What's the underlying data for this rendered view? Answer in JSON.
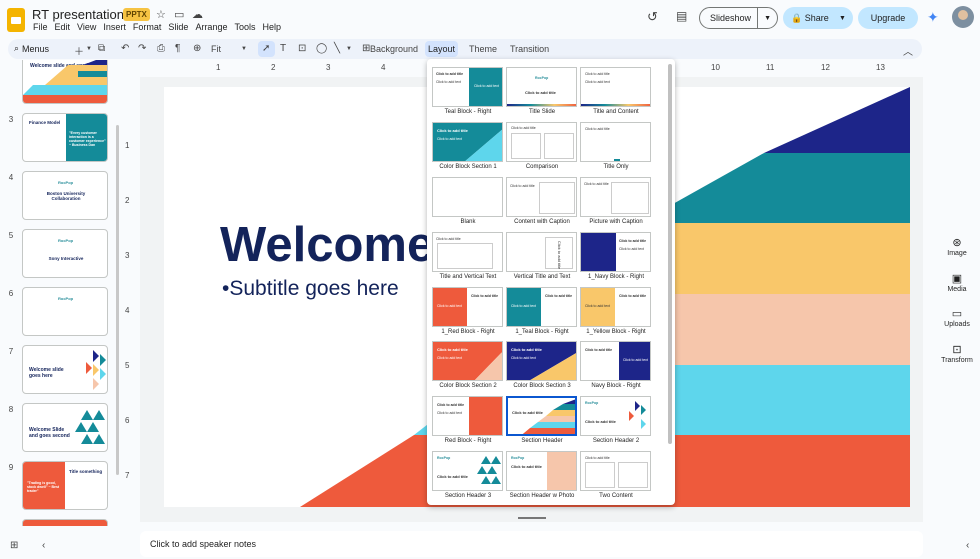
{
  "app": {
    "doc_title": "RT presentation v1",
    "badge": "PPTX",
    "icons": [
      "star-icon",
      "folder-icon",
      "cloud-icon"
    ]
  },
  "menu": [
    "File",
    "Edit",
    "View",
    "Insert",
    "Format",
    "Slide",
    "Arrange",
    "Tools",
    "Help"
  ],
  "header": {
    "slideshow_label": "Slideshow",
    "share_label": "Share",
    "upgrade_label": "Upgrade"
  },
  "toolbar": {
    "menus_label": "Menus",
    "zoom_label": "Fit",
    "background_label": "Background",
    "layout_label": "Layout",
    "theme_label": "Theme",
    "transition_label": "Transition"
  },
  "ruler": {
    "h": [
      "1",
      "2",
      "3",
      "4",
      "5",
      "6",
      "7",
      "8",
      "9",
      "10",
      "11",
      "12",
      "13"
    ],
    "v": [
      "1",
      "2",
      "3",
      "4",
      "5",
      "6",
      "7"
    ]
  },
  "filmstrip": [
    {
      "num": "",
      "title": "Welcome slide and another line"
    },
    {
      "num": "3",
      "title": "Finance Model",
      "quote": "\"Every customer interaction is a customer experience\" ~ Business Dan"
    },
    {
      "num": "4",
      "title": "Boston University Collaboration",
      "logo": "RocPop"
    },
    {
      "num": "5",
      "title": "Sony Interactive",
      "logo": "RocPop"
    },
    {
      "num": "6",
      "title": "",
      "logo": "RocPop"
    },
    {
      "num": "7",
      "title": "Welcome slide goes here"
    },
    {
      "num": "8",
      "title": "Welcome Slide and goes second"
    },
    {
      "num": "9",
      "title": "Title something",
      "quote": "\"Trading is good, stock dwell\" ~ Best trader\""
    }
  ],
  "slide": {
    "title": "Welcome",
    "subtitle": "Subtitle goes here",
    "stripes": [
      "#1d2589",
      "#148b99",
      "#f9c76a",
      "#f6c6ab",
      "#5ed6ec",
      "#ee5a3c"
    ]
  },
  "layouts": [
    "Teal Block - Right",
    "Title Slide",
    "Title and Content",
    "Color Block Section 1",
    "Comparison",
    "Title Only",
    "Blank",
    "Content with Caption",
    "Picture with Caption",
    "Title and Vertical Text",
    "Vertical Title and Text",
    "1_Navy Block - Right",
    "1_Red Block - Right",
    "1_Teal Block - Right",
    "1_Yellow Block - Right",
    "Color Block Section 2",
    "Color Block Section 3",
    "Navy Block - Right",
    "Red Block - Right",
    "Section Header",
    "Section Header 2",
    "Section Header 3",
    "Section Header w Photo",
    "Two Content"
  ],
  "layout_thumb_text": {
    "click_title": "Click to add title",
    "click_text": "Click to add text",
    "vertical_title": "Click to add title"
  },
  "right_side": [
    {
      "label": "Image",
      "icon": "image-sparkle-icon"
    },
    {
      "label": "Media",
      "icon": "media-icon"
    },
    {
      "label": "Uploads",
      "icon": "folder-upload-icon"
    },
    {
      "label": "Transform",
      "icon": "transform-icon"
    }
  ],
  "notes": {
    "placeholder": "Click to add speaker notes"
  }
}
